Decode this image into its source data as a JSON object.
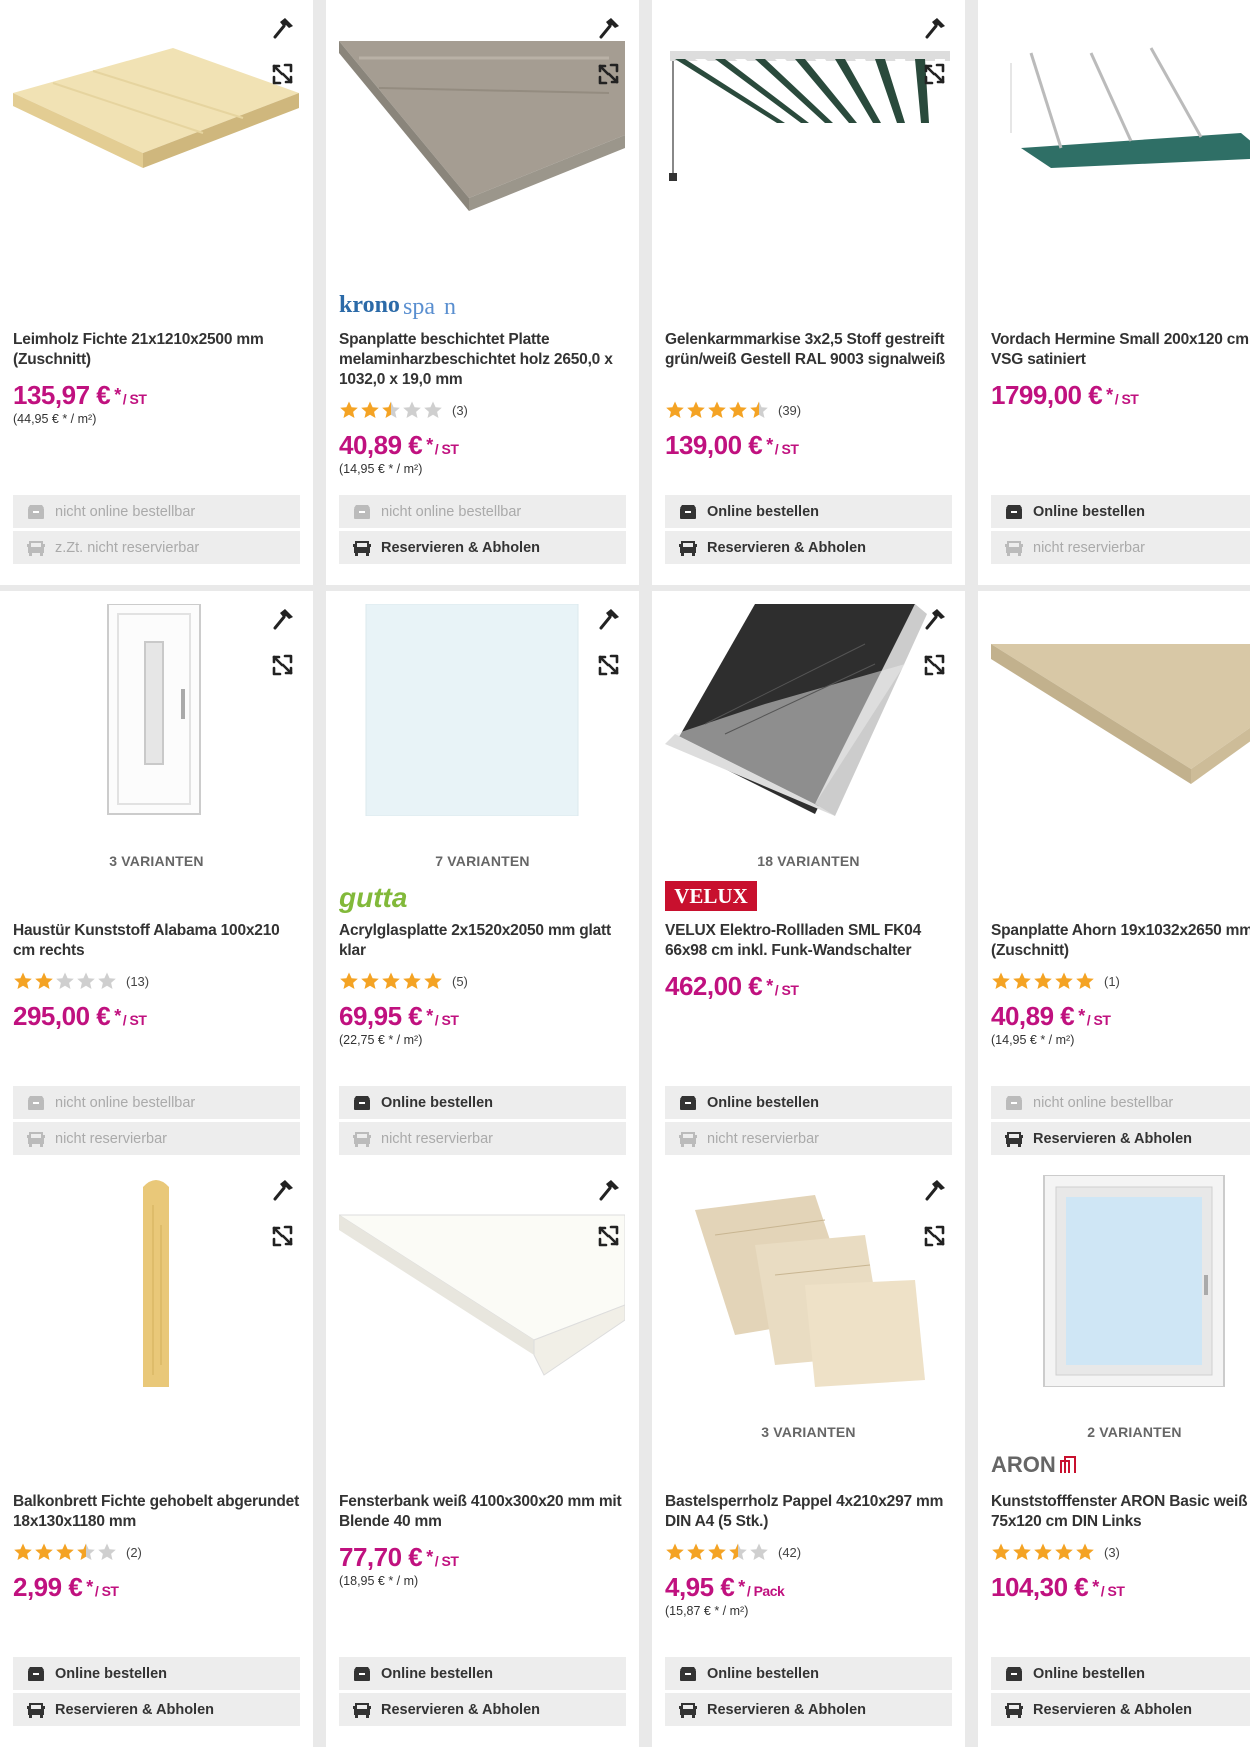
{
  "colors": {
    "price": "#c0117f",
    "star": "#f4a324",
    "star_empty": "#cfcfcf"
  },
  "products": [
    {
      "title": "Leimholz Fichte 21x1210x2500 mm (Zuschnitt)",
      "variants": "",
      "brand": "",
      "rating": null,
      "rating_count": "",
      "price": "135,97 €",
      "unit": "/ ST",
      "base_price": "(44,95 € * / m²)",
      "online": "nicht online bestellbar",
      "online_enabled": false,
      "reserve": "z.Zt. nicht reservierbar",
      "reserve_enabled": false,
      "image": "wood-panel"
    },
    {
      "title": "Spanplatte beschichtet Platte melaminharzbeschichtet holz 2650,0 x 1032,0 x 19,0 mm",
      "variants": "",
      "brand": "kronospan",
      "rating": 2.5,
      "rating_count": "(3)",
      "price": "40,89 €",
      "unit": "/ ST",
      "base_price": "(14,95 € * / m²)",
      "online": "nicht online bestellbar",
      "online_enabled": false,
      "reserve": "Reservieren & Abholen",
      "reserve_enabled": true,
      "image": "chipboard-oak"
    },
    {
      "title": "Gelenkarmmarkise 3x2,5 Stoff gestreift grün/weiß Gestell RAL 9003 signalweiß",
      "variants": "",
      "brand": "",
      "rating": 4.5,
      "rating_count": "(39)",
      "price": "139,00 €",
      "unit": "/ ST",
      "base_price": "",
      "online": "Online bestellen",
      "online_enabled": true,
      "reserve": "Reservieren & Abholen",
      "reserve_enabled": true,
      "image": "awning"
    },
    {
      "title": "Vordach Hermine Small 200x120 cm VSG satiniert",
      "variants": "",
      "brand": "",
      "rating": null,
      "rating_count": "",
      "price": "1799,00 €",
      "unit": "/ ST",
      "base_price": "",
      "online": "Online bestellen",
      "online_enabled": true,
      "reserve": "nicht reservierbar",
      "reserve_enabled": false,
      "image": "canopy"
    },
    {
      "title": "Haustür Kunststoff Alabama 100x210 cm rechts",
      "variants": "3 VARIANTEN",
      "brand": "",
      "rating": 2,
      "rating_count": "(13)",
      "price": "295,00 €",
      "unit": "/ ST",
      "base_price": "",
      "online": "nicht online bestellbar",
      "online_enabled": false,
      "reserve": "nicht reservierbar",
      "reserve_enabled": false,
      "image": "door"
    },
    {
      "title": "Acrylglasplatte 2x1520x2050 mm glatt klar",
      "variants": "7 VARIANTEN",
      "brand": "gutta",
      "rating": 5,
      "rating_count": "(5)",
      "price": "69,95 €",
      "unit": "/ ST",
      "base_price": "(22,75 € * / m²)",
      "online": "Online bestellen",
      "online_enabled": true,
      "reserve": "nicht reservierbar",
      "reserve_enabled": false,
      "image": "acrylic"
    },
    {
      "title": "VELUX Elektro-Rollladen SML FK04 66x98 cm inkl. Funk-Wandschalter",
      "variants": "18 VARIANTEN",
      "brand": "VELUX",
      "rating": null,
      "rating_count": "",
      "price": "462,00 €",
      "unit": "/ ST",
      "base_price": "",
      "online": "Online bestellen",
      "online_enabled": true,
      "reserve": "nicht reservierbar",
      "reserve_enabled": false,
      "image": "roof-window"
    },
    {
      "title": "Spanplatte Ahorn 19x1032x2650 mm (Zuschnitt)",
      "variants": "",
      "brand": "",
      "rating": 5,
      "rating_count": "(1)",
      "price": "40,89 €",
      "unit": "/ ST",
      "base_price": "(14,95 € * / m²)",
      "online": "nicht online bestellbar",
      "online_enabled": false,
      "reserve": "Reservieren & Abholen",
      "reserve_enabled": true,
      "image": "chipboard-maple"
    },
    {
      "title": "Balkonbrett Fichte gehobelt abgerundet 18x130x1180 mm",
      "variants": "",
      "brand": "",
      "rating": 3.5,
      "rating_count": "(2)",
      "price": "2,99 €",
      "unit": "/ ST",
      "base_price": "",
      "online": "Online bestellen",
      "online_enabled": true,
      "reserve": "Reservieren & Abholen",
      "reserve_enabled": true,
      "image": "board"
    },
    {
      "title": "Fensterbank weiß 4100x300x20 mm mit Blende 40 mm",
      "variants": "",
      "brand": "",
      "rating": null,
      "rating_count": "",
      "price": "77,70 €",
      "unit": "/ ST",
      "base_price": "(18,95 € * / m)",
      "online": "Online bestellen",
      "online_enabled": true,
      "reserve": "Reservieren & Abholen",
      "reserve_enabled": true,
      "image": "windowsill"
    },
    {
      "title": "Bastelsperrholz Pappel 4x210x297 mm DIN A4 (5 Stk.)",
      "variants": "3 VARIANTEN",
      "brand": "",
      "rating": 3.5,
      "rating_count": "(42)",
      "price": "4,95 €",
      "unit": "/ Pack",
      "base_price": "(15,87 € * / m²)",
      "online": "Online bestellen",
      "online_enabled": true,
      "reserve": "Reservieren & Abholen",
      "reserve_enabled": true,
      "image": "plywood"
    },
    {
      "title": "Kunststofffenster ARON Basic weiß 75x120 cm DIN Links",
      "variants": "2 VARIANTEN",
      "brand": "ARON",
      "rating": 5,
      "rating_count": "(3)",
      "price": "104,30 €",
      "unit": "/ ST",
      "base_price": "",
      "online": "Online bestellen",
      "online_enabled": true,
      "reserve": "Reservieren & Abholen",
      "reserve_enabled": true,
      "image": "window"
    }
  ]
}
